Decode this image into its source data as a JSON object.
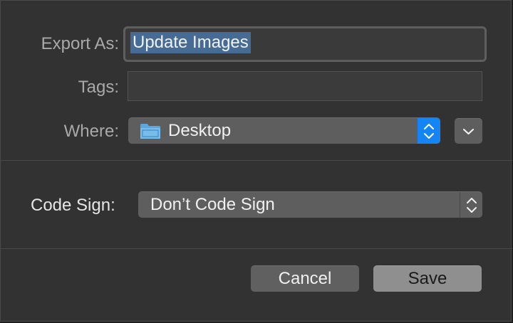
{
  "export_as": {
    "label": "Export As:",
    "value": "Update Images"
  },
  "tags": {
    "label": "Tags:",
    "value": ""
  },
  "where": {
    "label": "Where:",
    "value": "Desktop",
    "icon": "folder-icon"
  },
  "code_sign": {
    "label": "Code Sign:",
    "value": "Don’t Code Sign"
  },
  "buttons": {
    "cancel": "Cancel",
    "save": "Save"
  },
  "colors": {
    "accent": "#1584f5",
    "selection": "#466b94",
    "sheet_bg": "#323232"
  }
}
